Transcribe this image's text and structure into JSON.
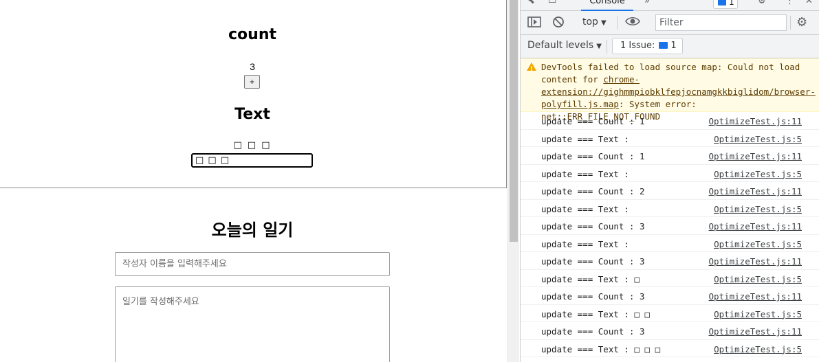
{
  "page": {
    "count_heading": "count",
    "count_value": "3",
    "plus_label": "+",
    "text_heading": "Text",
    "text_value": "□ □ □",
    "text_input_value": "□ □ □",
    "diary_title": "오늘의 일기",
    "author_placeholder": "작성자 이름을 입력해주세요",
    "content_placeholder": "일기를 작성해주세요"
  },
  "devtools": {
    "tab_console": "Console",
    "issues_count_top": "1",
    "context": "top",
    "filter_placeholder": "Filter",
    "default_levels": "Default levels",
    "issue_button": "1 Issue:",
    "issue_count": "1",
    "warning": {
      "prefix": "DevTools failed to load source map: Could not load content for ",
      "link": "chrome-extension://gighmmpiobklfepjocnamgkkbiglidom/browser-polyfill.js.map",
      "suffix": ": System error: net::ERR_FILE_NOT_FOUND"
    },
    "logs": [
      {
        "msg": "update === Count : 1",
        "src": "OptimizeTest.js:11"
      },
      {
        "msg": "update === Text :",
        "src": "OptimizeTest.js:5"
      },
      {
        "msg": "update === Count : 1",
        "src": "OptimizeTest.js:11"
      },
      {
        "msg": "update === Text :",
        "src": "OptimizeTest.js:5"
      },
      {
        "msg": "update === Count : 2",
        "src": "OptimizeTest.js:11"
      },
      {
        "msg": "update === Text :",
        "src": "OptimizeTest.js:5"
      },
      {
        "msg": "update === Count : 3",
        "src": "OptimizeTest.js:11"
      },
      {
        "msg": "update === Text :",
        "src": "OptimizeTest.js:5"
      },
      {
        "msg": "update === Count : 3",
        "src": "OptimizeTest.js:11"
      },
      {
        "msg": "update === Text : □",
        "src": "OptimizeTest.js:5"
      },
      {
        "msg": "update === Count : 3",
        "src": "OptimizeTest.js:11"
      },
      {
        "msg": "update === Text : □ □",
        "src": "OptimizeTest.js:5"
      },
      {
        "msg": "update === Count : 3",
        "src": "OptimizeTest.js:11"
      },
      {
        "msg": "update === Text : □ □ □",
        "src": "OptimizeTest.js:5"
      }
    ]
  }
}
